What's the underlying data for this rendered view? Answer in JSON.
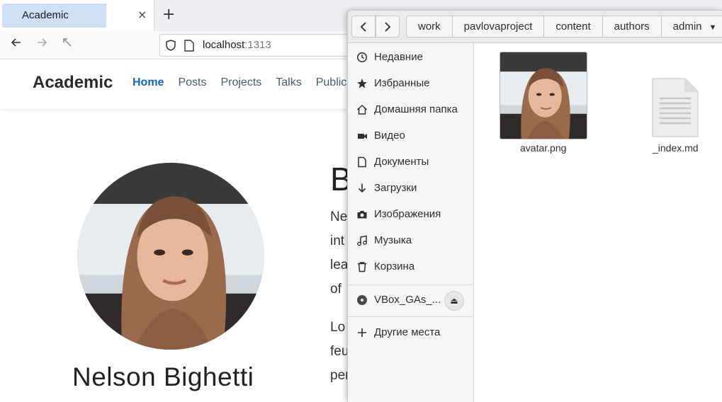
{
  "browser": {
    "tab_title": "Academic",
    "tab_close": "×",
    "new_tab": "+",
    "url_host": "localhost",
    "url_port": ":1313"
  },
  "site": {
    "brand": "Academic",
    "nav": [
      "Home",
      "Posts",
      "Projects",
      "Talks",
      "Publications"
    ],
    "person_name": "Nelson Bighetti",
    "bio_heading": "B",
    "bio_lines": [
      "Ne",
      "int",
      "lea",
      "of",
      "Lo",
      "feu",
      "per"
    ]
  },
  "file_manager": {
    "breadcrumbs": [
      "work",
      "pavlovaproject",
      "content",
      "authors",
      "admin"
    ],
    "sidebar": [
      {
        "label": "Недавние",
        "icon": "clock-icon"
      },
      {
        "label": "Избранные",
        "icon": "star-icon"
      },
      {
        "label": "Домашняя папка",
        "icon": "home-icon"
      },
      {
        "label": "Видео",
        "icon": "video-icon"
      },
      {
        "label": "Документы",
        "icon": "document-icon"
      },
      {
        "label": "Загрузки",
        "icon": "download-icon"
      },
      {
        "label": "Изображения",
        "icon": "camera-icon"
      },
      {
        "label": "Музыка",
        "icon": "music-icon"
      },
      {
        "label": "Корзина",
        "icon": "trash-icon"
      }
    ],
    "device": {
      "label": "VBox_GAs_...",
      "icon": "disc-icon"
    },
    "other_places": "Другие места",
    "files": [
      {
        "name": "avatar.png",
        "type": "image"
      },
      {
        "name": "_index.md",
        "type": "text"
      }
    ]
  },
  "colors": {
    "accent": "#1565c0",
    "tab_highlight": "#cfe0f5",
    "sidebar_bg": "#f6f6f6"
  }
}
